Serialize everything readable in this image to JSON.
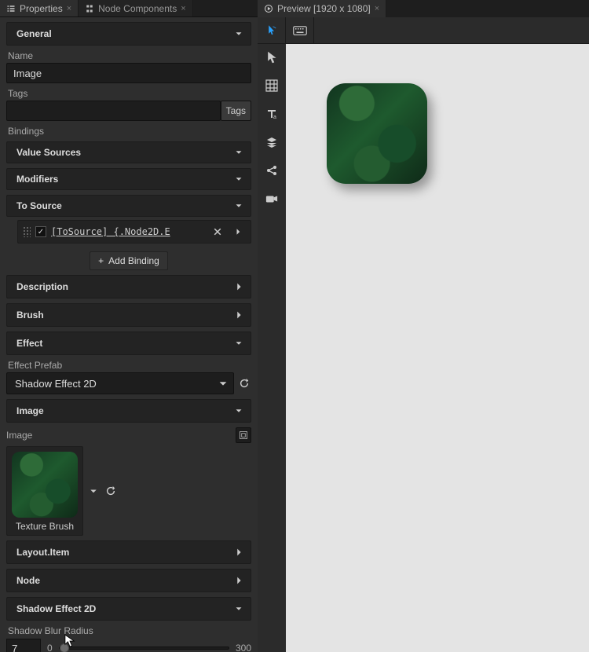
{
  "tabs": {
    "props_label": "Properties",
    "nodes_label": "Node Components",
    "preview_label": "Preview [1920 x 1080]"
  },
  "sections": {
    "general": "General",
    "value_sources": "Value Sources",
    "modifiers": "Modifiers",
    "to_source": "To Source",
    "description": "Description",
    "brush": "Brush",
    "effect": "Effect",
    "image": "Image",
    "layout_item": "Layout.Item",
    "node": "Node",
    "shadow_effect_section": "Shadow Effect 2D"
  },
  "labels": {
    "name": "Name",
    "tags": "Tags",
    "bindings": "Bindings",
    "tags_btn": "Tags",
    "add_binding": "Add Binding",
    "effect_prefab": "Effect Prefab",
    "image_label": "Image",
    "texture_brush": "Texture Brush",
    "shadow_blur_radius": "Shadow Blur Radius"
  },
  "values": {
    "name": "Image",
    "tags": "",
    "binding_expr": "[ToSource] {.Node2D.E",
    "binding_checked": true,
    "effect_prefab_selected": "Shadow Effect 2D",
    "shadow_blur_value": "7",
    "shadow_blur_min": "0",
    "shadow_blur_max": "300"
  }
}
